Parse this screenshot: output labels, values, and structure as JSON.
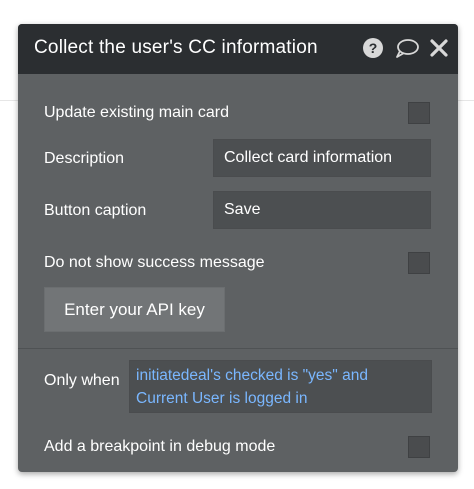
{
  "dialog": {
    "title": "Collect the user's CC information",
    "icons": {
      "help": "question-circle-icon",
      "comment": "speech-bubble-icon",
      "close": "close-icon"
    }
  },
  "fields": {
    "update_main_card": {
      "label": "Update existing main card",
      "checked": false
    },
    "description": {
      "label": "Description",
      "value": "Collect card information"
    },
    "button_caption": {
      "label": "Button caption",
      "value": "Save"
    },
    "no_success_message": {
      "label": "Do not show success message",
      "checked": false
    },
    "api_key_button": {
      "label": "Enter your API key"
    },
    "only_when": {
      "label": "Only when",
      "line1": "initiatedeal's checked is \"yes\" and",
      "line2": "Current User is logged in"
    },
    "breakpoint": {
      "label": "Add a breakpoint in debug mode",
      "checked": false
    }
  },
  "colors": {
    "header_bg": "#2b2e31",
    "panel_bg": "#5e6163",
    "input_bg": "#4c4f51",
    "condition_text": "#7ab7ff"
  }
}
